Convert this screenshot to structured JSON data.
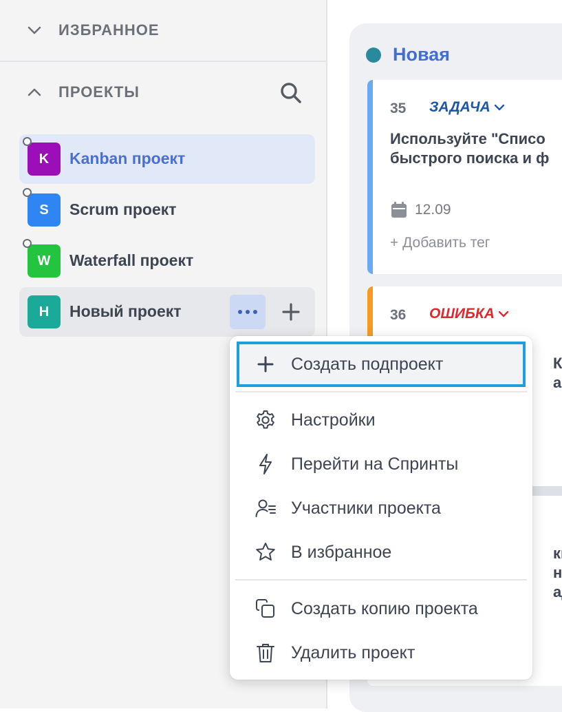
{
  "sidebar": {
    "favorites_label": "ИЗБРАННОЕ",
    "projects_label": "ПРОЕКТЫ",
    "projects": [
      {
        "letter": "K",
        "name": "Kanban проект",
        "color": "#9c0fb8"
      },
      {
        "letter": "S",
        "name": "Scrum проект",
        "color": "#2f86f2"
      },
      {
        "letter": "W",
        "name": "Waterfall проект",
        "color": "#23c43f"
      },
      {
        "letter": "Н",
        "name": "Новый проект",
        "color": "#1ba99a"
      }
    ]
  },
  "board": {
    "column_title": "Новая",
    "column_color": "#2a8a9c",
    "cards": [
      {
        "number": "35",
        "type": "ЗАДАЧА",
        "type_color": "#1e56a8",
        "bar_color": "#6aaaf3",
        "text_line1": "Используйте \"Списо",
        "text_line2": "быстрого поиска и ф",
        "date": "12.09",
        "add_tag": "+ Добавить тег"
      },
      {
        "number": "36",
        "type": "ОШИБКА",
        "type_color": "#e0262f",
        "bar_color": "#f59a23",
        "text_line1": "Клон",
        "text_line2": "ации"
      }
    ],
    "card3_fragments": [
      "кци",
      "ного",
      "адач"
    ]
  },
  "menu": {
    "items": [
      {
        "label": "Создать подпроект",
        "icon": "plus-icon"
      },
      {
        "label": "Настройки",
        "icon": "gear-icon"
      },
      {
        "label": "Перейти на Спринты",
        "icon": "lightning-icon"
      },
      {
        "label": "Участники проекта",
        "icon": "users-list-icon"
      },
      {
        "label": "В избранное",
        "icon": "star-icon"
      },
      {
        "label": "Создать копию проекта",
        "icon": "copy-icon"
      },
      {
        "label": "Удалить проект",
        "icon": "trash-icon"
      }
    ]
  }
}
